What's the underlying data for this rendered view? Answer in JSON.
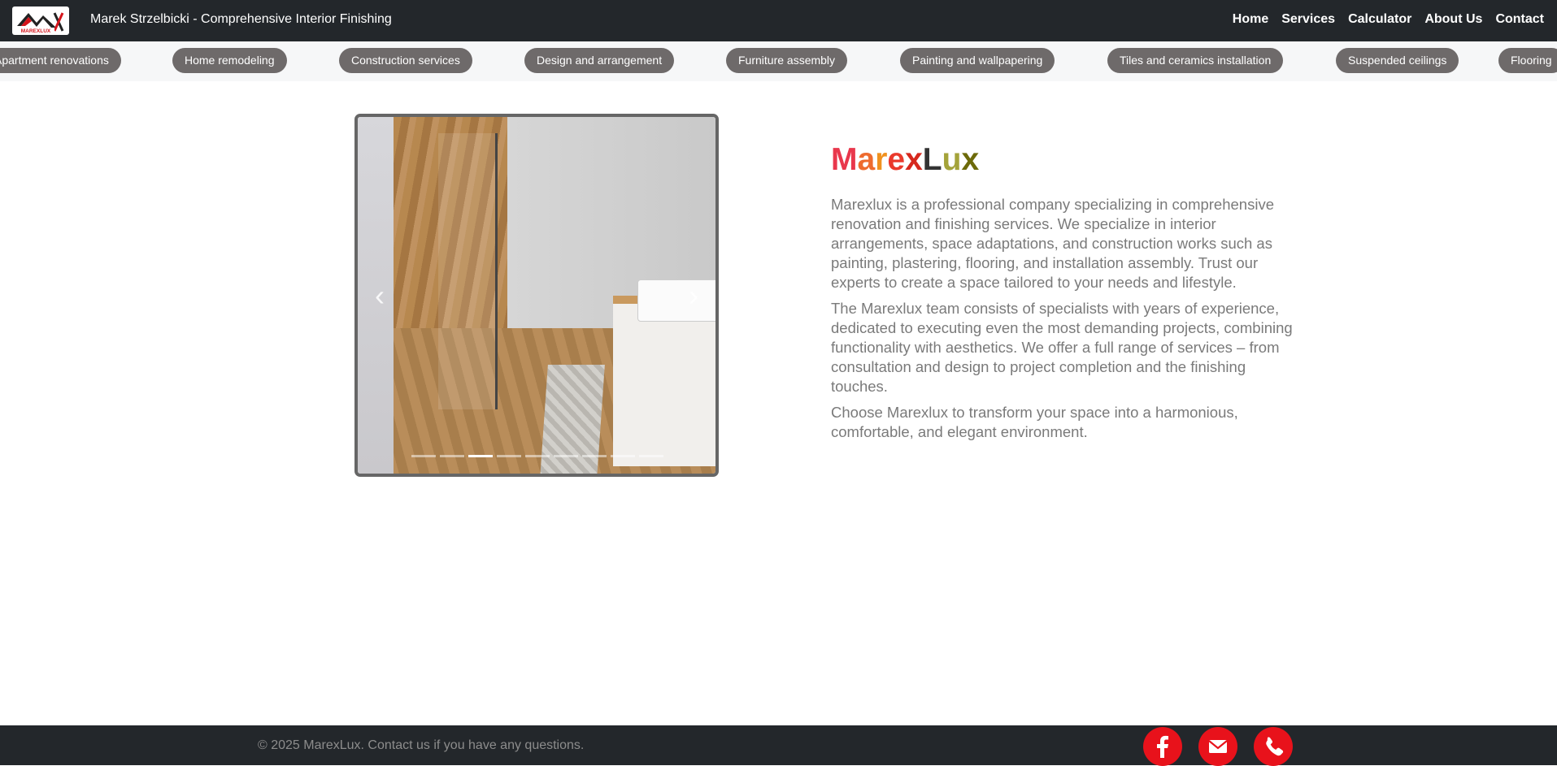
{
  "navbar": {
    "brand": "Marek Strzelbicki - Comprehensive Interior Finishing",
    "logo_text": "MAREXLUX",
    "links": [
      "Home",
      "Services",
      "Calculator",
      "About Us",
      "Contact"
    ]
  },
  "ticker": {
    "items": [
      "Apartment renovations",
      "Home remodeling",
      "Construction services",
      "Design and arrangement",
      "Furniture assembly",
      "Painting and wallpapering",
      "Tiles and ceramics installation",
      "Suspended ceilings",
      "Flooring"
    ]
  },
  "carousel": {
    "prev_icon": "chevron-left-icon",
    "next_icon": "chevron-right-icon",
    "slide_count": 9,
    "active_index": 2
  },
  "about": {
    "title_parts": [
      "M",
      "a",
      "r",
      "e",
      "x",
      "L",
      "u",
      "x"
    ],
    "title_colors": [
      "#e9374c",
      "#ee6b2e",
      "#f0911f",
      "#ea3a2c",
      "#d6281d",
      "#333333",
      "#a4a33a",
      "#6d6a0a"
    ],
    "paragraphs": [
      "Marexlux is a professional company specializing in comprehensive renovation and finishing services. We specialize in interior arrangements, space adaptations, and construction works such as painting, plastering, flooring, and installation assembly. Trust our experts to create a space tailored to your needs and lifestyle.",
      "The Marexlux team consists of specialists with years of experience, dedicated to executing even the most demanding projects, combining functionality with aesthetics. We offer a full range of services – from consultation and design to project completion and the finishing touches.",
      "Choose Marexlux to transform your space into a harmonious, comfortable, and elegant environment."
    ]
  },
  "footer": {
    "copyright": "© 2025 MarexLux. Contact us if you have any questions.",
    "social": [
      "facebook-icon",
      "email-icon",
      "phone-icon"
    ],
    "accent": "#e8121b"
  }
}
